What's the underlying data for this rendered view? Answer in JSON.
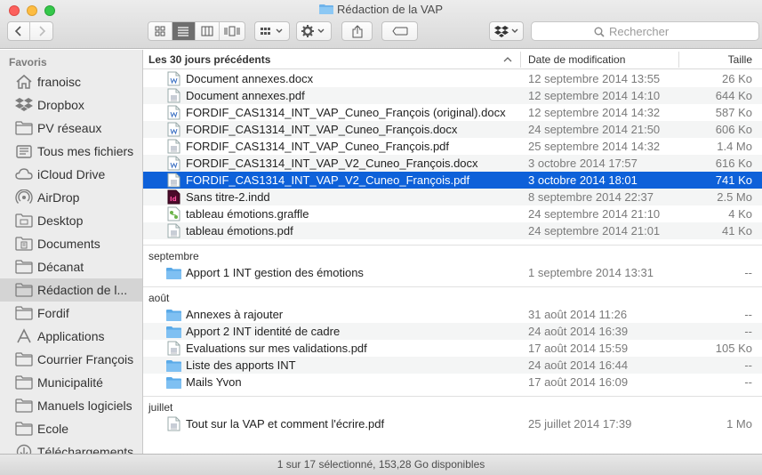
{
  "window": {
    "title": "Rédaction de la VAP"
  },
  "toolbar": {
    "search_placeholder": "Rechercher",
    "icons": [
      "back-icon",
      "forward-icon",
      "icon-view-icon",
      "list-view-icon",
      "column-view-icon",
      "coverflow-view-icon",
      "arrange-icon",
      "action-gear-icon",
      "share-icon",
      "tag-icon",
      "dropbox-icon",
      "search-icon"
    ]
  },
  "sidebar": {
    "heading": "Favoris",
    "items": [
      {
        "label": "franoisc",
        "icon": "home-icon"
      },
      {
        "label": "Dropbox",
        "icon": "dropbox-icon"
      },
      {
        "label": "PV réseaux",
        "icon": "folder-icon"
      },
      {
        "label": "Tous mes fichiers",
        "icon": "all-files-icon"
      },
      {
        "label": "iCloud Drive",
        "icon": "cloud-icon"
      },
      {
        "label": "AirDrop",
        "icon": "airdrop-icon"
      },
      {
        "label": "Desktop",
        "icon": "desktop-folder-icon"
      },
      {
        "label": "Documents",
        "icon": "documents-folder-icon"
      },
      {
        "label": "Décanat",
        "icon": "folder-icon"
      },
      {
        "label": "Rédaction de l...",
        "icon": "folder-icon",
        "selected": true
      },
      {
        "label": "Fordif",
        "icon": "folder-icon"
      },
      {
        "label": "Applications",
        "icon": "applications-icon"
      },
      {
        "label": "Courrier François",
        "icon": "folder-icon"
      },
      {
        "label": "Municipalité",
        "icon": "folder-icon"
      },
      {
        "label": "Manuels logiciels",
        "icon": "folder-icon"
      },
      {
        "label": "Ecole",
        "icon": "folder-icon"
      },
      {
        "label": "Téléchargements",
        "icon": "downloads-icon"
      }
    ]
  },
  "columns": {
    "name": "Les 30 jours précédents",
    "date": "Date de modification",
    "size": "Taille"
  },
  "groups": [
    {
      "label": "",
      "rows": [
        {
          "name": "Document annexes.docx",
          "date": "12 septembre 2014 13:55",
          "size": "26 Ko",
          "icon": "docx-file-icon"
        },
        {
          "name": "Document annexes.pdf",
          "date": "12 septembre 2014 14:10",
          "size": "644 Ko",
          "icon": "pdf-file-icon"
        },
        {
          "name": "FORDIF_CAS1314_INT_VAP_Cuneo_François (original).docx",
          "date": "12 septembre 2014 14:32",
          "size": "587 Ko",
          "icon": "docx-file-icon"
        },
        {
          "name": "FORDIF_CAS1314_INT_VAP_Cuneo_François.docx",
          "date": "24 septembre 2014 21:50",
          "size": "606 Ko",
          "icon": "docx-file-icon"
        },
        {
          "name": "FORDIF_CAS1314_INT_VAP_Cuneo_François.pdf",
          "date": "25 septembre 2014 14:32",
          "size": "1.4 Mo",
          "icon": "pdf-file-icon"
        },
        {
          "name": "FORDIF_CAS1314_INT_VAP_V2_Cuneo_François.docx",
          "date": "3 octobre 2014 17:57",
          "size": "616 Ko",
          "icon": "docx-file-icon"
        },
        {
          "name": "FORDIF_CAS1314_INT_VAP_V2_Cuneo_François.pdf",
          "date": "3 octobre 2014 18:01",
          "size": "741 Ko",
          "icon": "pdf-file-icon",
          "selected": true
        },
        {
          "name": "Sans titre-2.indd",
          "date": "8 septembre 2014 22:37",
          "size": "2.5 Mo",
          "icon": "indesign-file-icon"
        },
        {
          "name": "tableau émotions.graffle",
          "date": "24 septembre 2014 21:10",
          "size": "4 Ko",
          "icon": "graffle-file-icon"
        },
        {
          "name": "tableau émotions.pdf",
          "date": "24 septembre 2014 21:01",
          "size": "41 Ko",
          "icon": "pdf-file-icon"
        }
      ]
    },
    {
      "label": "septembre",
      "rows": [
        {
          "name": "Apport 1 INT gestion des émotions",
          "date": "1 septembre 2014 13:31",
          "size": "--",
          "icon": "folder-icon"
        }
      ]
    },
    {
      "label": "août",
      "rows": [
        {
          "name": "Annexes à rajouter",
          "date": "31 août 2014 11:26",
          "size": "--",
          "icon": "folder-icon"
        },
        {
          "name": "Apport 2 INT identité de cadre",
          "date": "24 août 2014 16:39",
          "size": "--",
          "icon": "folder-icon"
        },
        {
          "name": "Evaluations sur mes validations.pdf",
          "date": "17 août 2014 15:59",
          "size": "105 Ko",
          "icon": "pdf-file-icon"
        },
        {
          "name": "Liste des apports INT",
          "date": "24 août 2014 16:44",
          "size": "--",
          "icon": "folder-icon"
        },
        {
          "name": "Mails Yvon",
          "date": "17 août 2014 16:09",
          "size": "--",
          "icon": "folder-icon"
        }
      ]
    },
    {
      "label": "juillet",
      "rows": [
        {
          "name": "Tout sur la VAP et comment l'écrire.pdf",
          "date": "25 juillet 2014 17:39",
          "size": "1 Mo",
          "icon": "pdf-file-icon"
        }
      ]
    }
  ],
  "status": {
    "text": "1 sur 17 sélectionné, 153,28 Go disponibles"
  }
}
